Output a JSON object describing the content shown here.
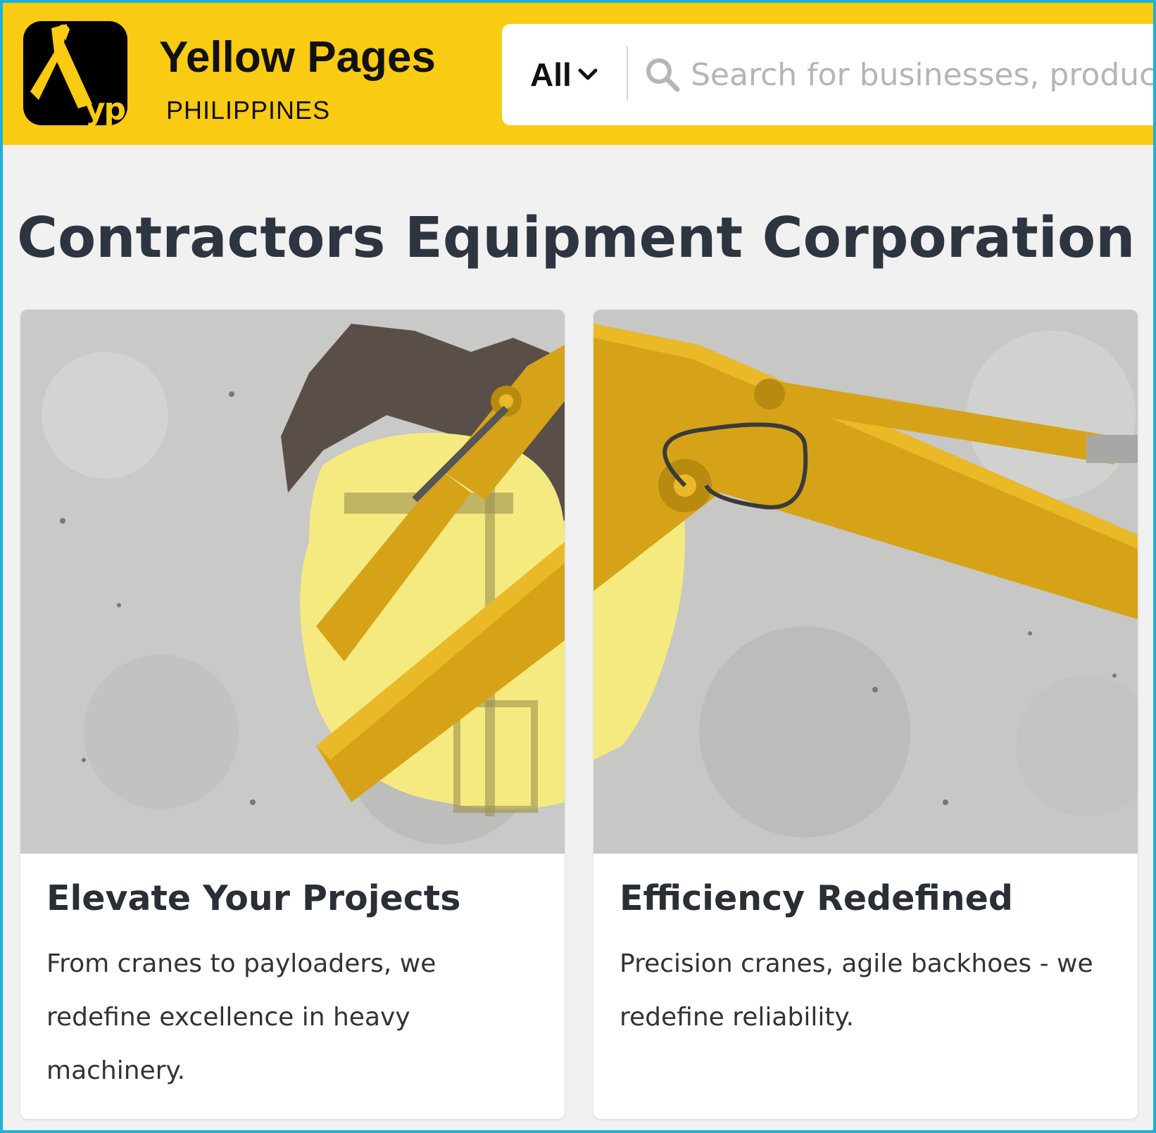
{
  "header": {
    "brand_name": "Yellow Pages",
    "brand_sub": "PHILIPPINES",
    "logo_text": "yp",
    "accent_color": "#f9cb12",
    "search": {
      "scope_label": "All",
      "placeholder": "Search for businesses, products, services"
    }
  },
  "page": {
    "title": "Contractors Equipment Corporation"
  },
  "cards": [
    {
      "image_icon": "excavator-arm-through-concrete",
      "title": "Elevate Your Projects",
      "text": "From cranes to payloaders, we redefine excellence in heavy machinery."
    },
    {
      "image_icon": "excavator-boom-concrete-wall",
      "title": "Efficiency Redefined",
      "text": "Precision cranes, agile backhoes - we redefine reliability."
    }
  ]
}
